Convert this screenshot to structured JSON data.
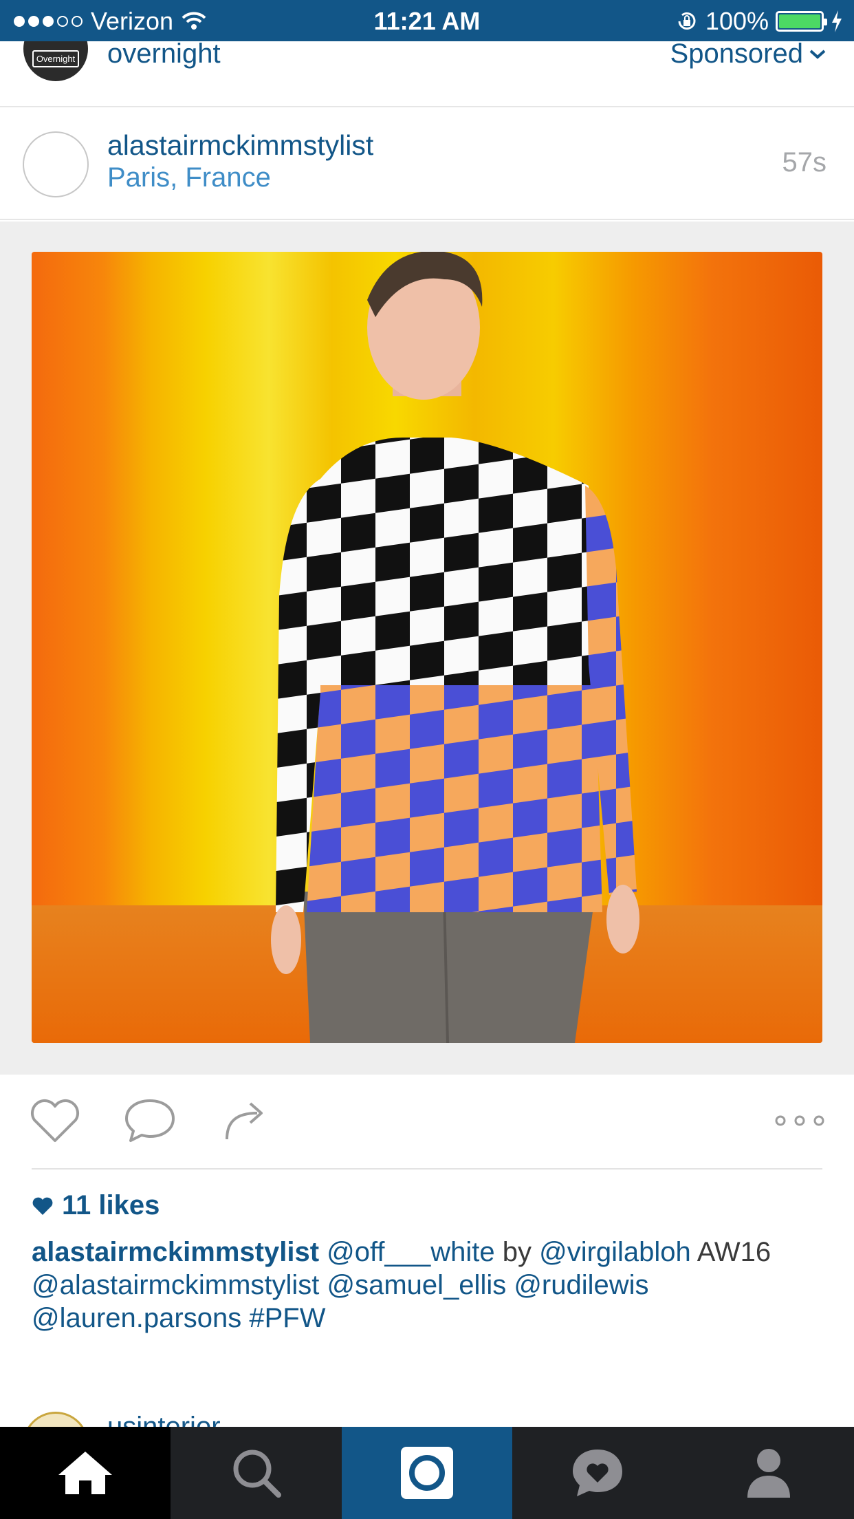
{
  "status_bar": {
    "carrier": "Verizon",
    "time": "11:21 AM",
    "battery_percent": "100%"
  },
  "sponsored_post": {
    "username": "overnight",
    "avatar_text": "Overnight",
    "label": "Sponsored"
  },
  "post": {
    "username": "alastairmckimmstylist",
    "location": "Paris, France",
    "time_ago": "57s",
    "likes": "11 likes",
    "caption_owner": "alastairmckimmstylist",
    "caption_parts": [
      {
        "text": " @off___white",
        "link": true
      },
      {
        "text": " by ",
        "link": false
      },
      {
        "text": "@virgilabloh",
        "link": true
      },
      {
        "text": " AW16 ",
        "link": false
      },
      {
        "text": "@alastairmckimmstylist @samuel_ellis @rudilewis @lauren.parsons #PFW",
        "link": true
      }
    ]
  },
  "next_post": {
    "username": "usinterior"
  },
  "tab_bar": {
    "tabs": [
      "home-icon",
      "search-icon",
      "camera-icon",
      "activity-icon",
      "profile-icon"
    ],
    "active": "home"
  },
  "colors": {
    "brand": "#125688",
    "link": "#3f8dc7",
    "muted": "#a5a7aa"
  }
}
